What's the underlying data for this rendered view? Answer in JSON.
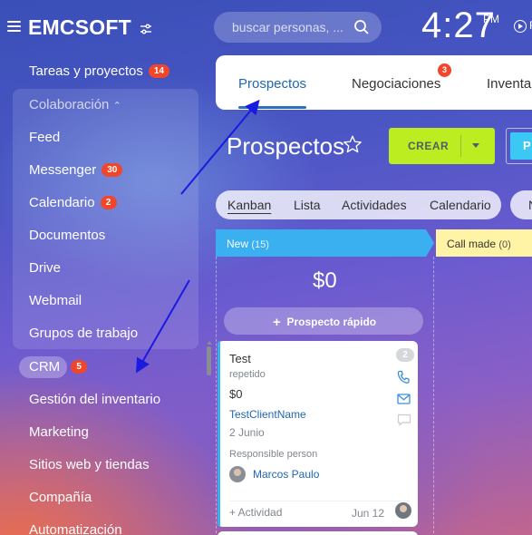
{
  "header": {
    "logo": "EMCSOFT",
    "search_placeholder": "buscar personas, ...",
    "clock_time": "4:27",
    "clock_ampm": "PM",
    "play_text": "F"
  },
  "sidebar": {
    "items": [
      {
        "label": "Tareas y proyectos",
        "counter": "14"
      },
      {
        "label": "Colaboración"
      },
      {
        "label": "Feed"
      },
      {
        "label": "Messenger",
        "counter": "30"
      },
      {
        "label": "Calendario",
        "counter": "2"
      },
      {
        "label": "Documentos"
      },
      {
        "label": "Drive"
      },
      {
        "label": "Webmail"
      },
      {
        "label": "Grupos de trabajo"
      },
      {
        "label": "CRM",
        "counter": "5"
      },
      {
        "label": "Gestión del inventario"
      },
      {
        "label": "Marketing"
      },
      {
        "label": "Sitios web y tiendas"
      },
      {
        "label": "Compañía"
      },
      {
        "label": "Automatización"
      }
    ]
  },
  "tabs": [
    {
      "label": "Prospectos"
    },
    {
      "label": "Negociaciones",
      "badge": "3"
    },
    {
      "label": "Inventa"
    }
  ],
  "page": {
    "title": "Prospectos",
    "create_label": "CREAR",
    "extra_button_label": "P"
  },
  "views": [
    {
      "label": "Kanban"
    },
    {
      "label": "Lista"
    },
    {
      "label": "Actividades"
    },
    {
      "label": "Calendario"
    },
    {
      "label": "N"
    }
  ],
  "kanban": {
    "columns": [
      {
        "name": "New",
        "count": "(15)",
        "sum": "$0",
        "quick_add": "Prospecto rápido"
      },
      {
        "name": "Call made",
        "count": "(0)"
      }
    ],
    "card": {
      "title": "Test",
      "subtitle": "repetido",
      "amount": "$0",
      "client": "TestClientName",
      "date": "2 Junio",
      "responsible_label": "Responsible person",
      "responsible_name": "Marcos Paulo",
      "badge": "2",
      "activity": "+ Actividad",
      "activity_date": "Jun 12"
    }
  },
  "colors": {
    "accent_blue": "#2067b0",
    "create_button": "#bbed21",
    "column_new": "#3bb0f0",
    "column_call": "#fff3a6",
    "counter_red": "#f0462a",
    "arrow": "#1a1ae0"
  }
}
